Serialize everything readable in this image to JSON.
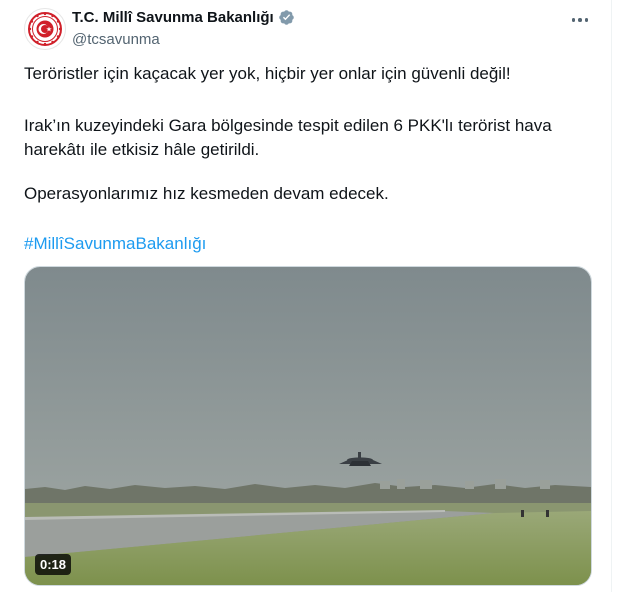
{
  "account": {
    "display_name": "T.C. Millî Savunma Bakanlığı",
    "handle": "@tcsavunma",
    "verified_badge_icon": "verified-badge-icon",
    "verified_color": "#829aab"
  },
  "tweet": {
    "line1": "Teröristler için kaçacak yer yok, hiçbir yer onlar için güvenli değil!",
    "line2": "Irak’ın kuzeyindeki Gara bölgesinde tespit edilen 6 PKK'lı terörist hava harekâtı ile etkisiz hâle getirildi.",
    "line3": "Operasyonlarımız hız kesmeden devam edecek.",
    "hashtag": "#MillîSavunmaBakanlığı"
  },
  "media": {
    "duration": "0:18"
  },
  "colors": {
    "link": "#1d9bf0",
    "text": "#0f1419",
    "secondary": "#536471"
  }
}
